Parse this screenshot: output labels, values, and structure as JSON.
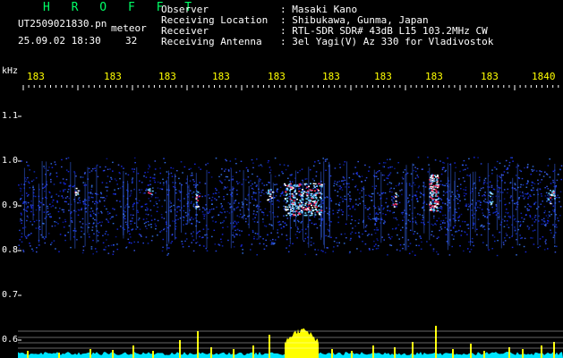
{
  "header": {
    "title": "H R O F F T",
    "filename": "UT2509021830.pn",
    "tag": "meteor",
    "datetime": "25.09.02 18:30",
    "count": "32"
  },
  "info": [
    {
      "label": "Observer",
      "value": ": Masaki Kano"
    },
    {
      "label": "Receiving Location",
      "value": ": Shibukawa, Gunma, Japan"
    },
    {
      "label": "Receiver",
      "value": ": RTL-SDR SDR# 43dB L15 103.2MHz CW"
    },
    {
      "label": "Receiving Antenna",
      "value": ": 3el Yagi(V) Az 330 for Vladivostok"
    }
  ],
  "axes": {
    "x_unit": "kHz",
    "x_ticks": [
      "183",
      "183",
      "183",
      "183",
      "183",
      "183",
      "183",
      "183",
      "183",
      "1840"
    ],
    "y_ticks": [
      "1.1",
      "1.0",
      "0.9",
      "0.8",
      "0.7",
      "0.6"
    ]
  },
  "colors": {
    "title": "#00ff66",
    "freq_labels": "#ffff00",
    "noise_low": "#1a2cff",
    "noise_high": "#ff3366",
    "spectrum_base": "#00e5ff",
    "spectrum_peaks": "#ffff00"
  }
}
